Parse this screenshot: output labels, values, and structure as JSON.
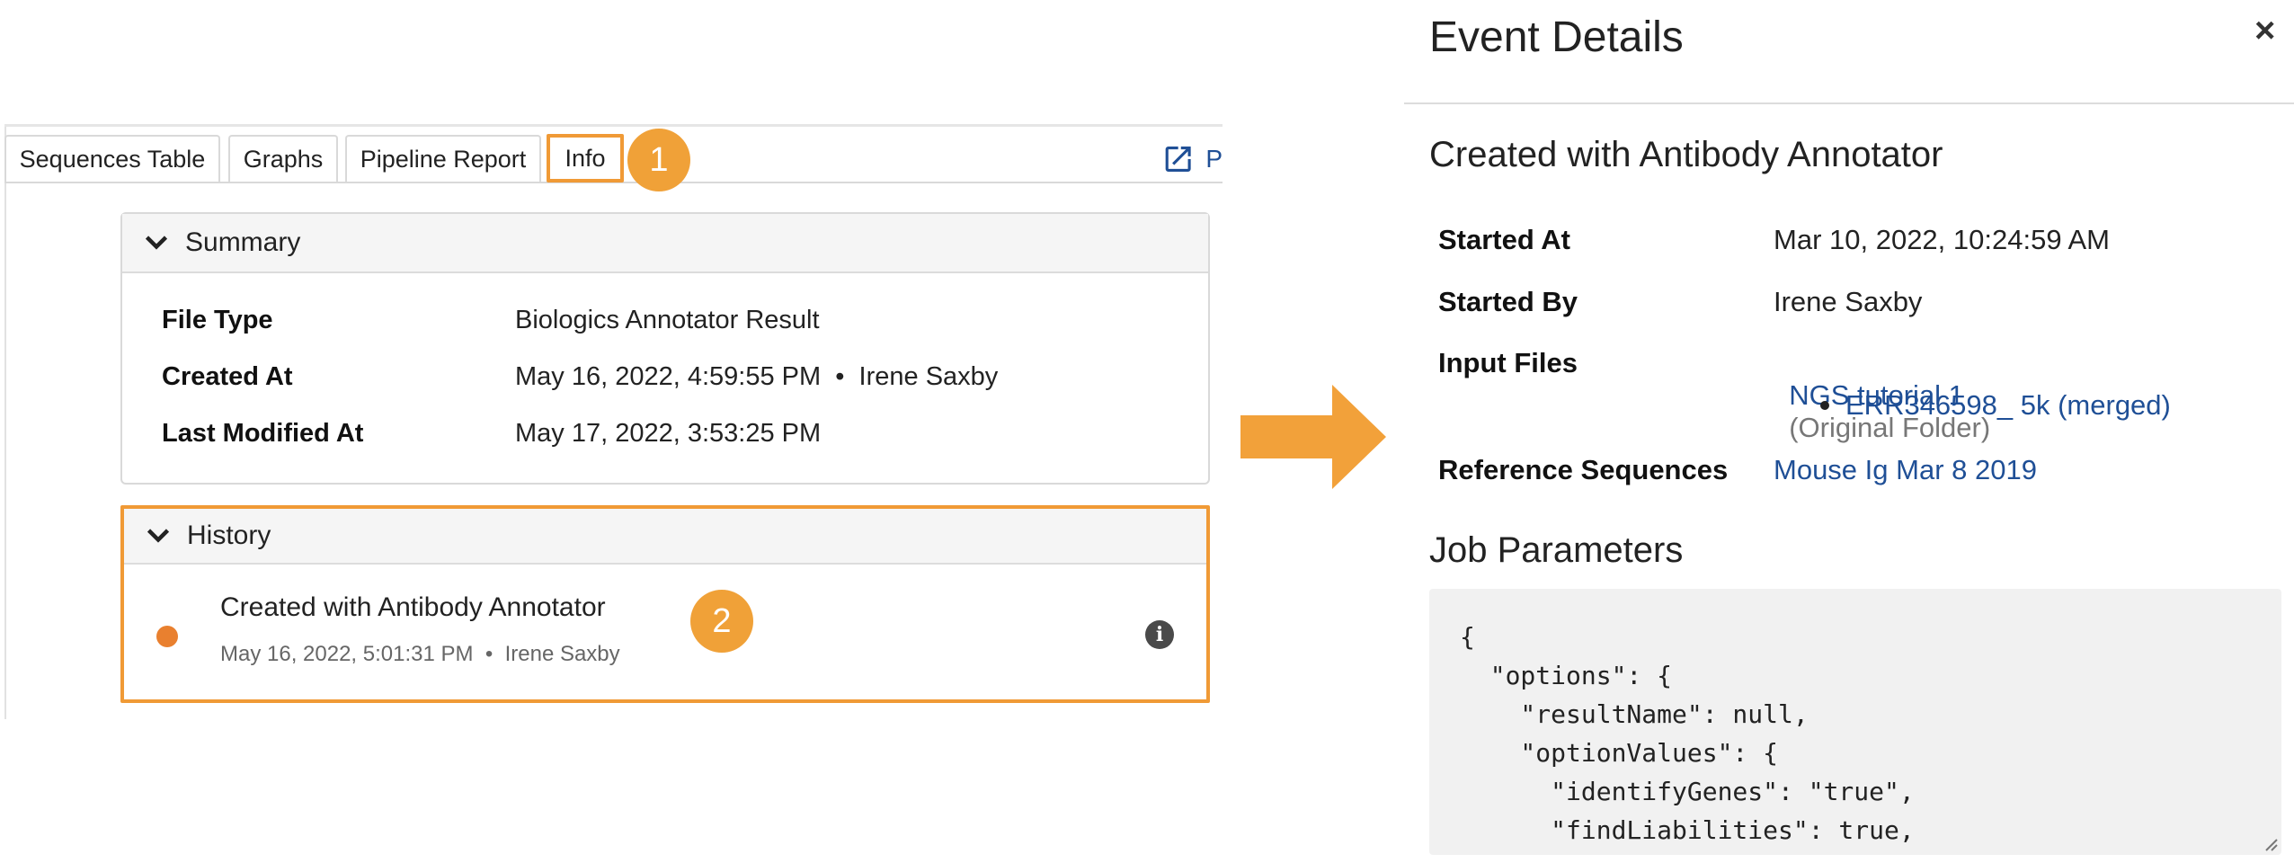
{
  "tabs": [
    {
      "label": "Sequences Table"
    },
    {
      "label": "Graphs"
    },
    {
      "label": "Pipeline Report"
    },
    {
      "label": "Info"
    }
  ],
  "callouts": {
    "one": "1",
    "two": "2"
  },
  "external_link": {
    "label": "P"
  },
  "summary": {
    "header": "Summary",
    "rows": [
      {
        "key": "File Type",
        "value": "Biologics Annotator Result"
      },
      {
        "key": "Created At",
        "value": "May 16, 2022, 4:59:55 PM  •  Irene Saxby"
      },
      {
        "key": "Last Modified At",
        "value": "May 17, 2022, 3:53:25 PM"
      }
    ]
  },
  "history": {
    "header": "History",
    "event_title": "Created with Antibody Annotator",
    "event_meta": "May 16, 2022, 5:01:31 PM  •  Irene Saxby",
    "info_glyph": "i"
  },
  "event_details": {
    "title": "Event Details",
    "close_glyph": "×",
    "subtitle": "Created with Antibody Annotator",
    "rows": {
      "started_at": {
        "key": "Started At",
        "value": "Mar 10, 2022, 10:24:59 AM"
      },
      "started_by": {
        "key": "Started By",
        "value": "Irene Saxby"
      },
      "input_files": {
        "key": "Input Files",
        "link": "NGS tutorial 1",
        "note": "(Original Folder)",
        "sub_link": "ERR346598_ 5k (merged)"
      },
      "reference": {
        "key": "Reference Sequences",
        "link": "Mouse Ig Mar 8 2019"
      }
    },
    "job_parameters_heading": "Job Parameters",
    "job_parameters_code": "{\n  \"options\": {\n    \"resultName\": null,\n    \"optionValues\": {\n      \"identifyGenes\": \"true\",\n      \"findLiabilities\": true,"
  },
  "colors": {
    "highlight": "#f09a36",
    "link": "#1f4f96",
    "history_dot": "#e9802f"
  }
}
